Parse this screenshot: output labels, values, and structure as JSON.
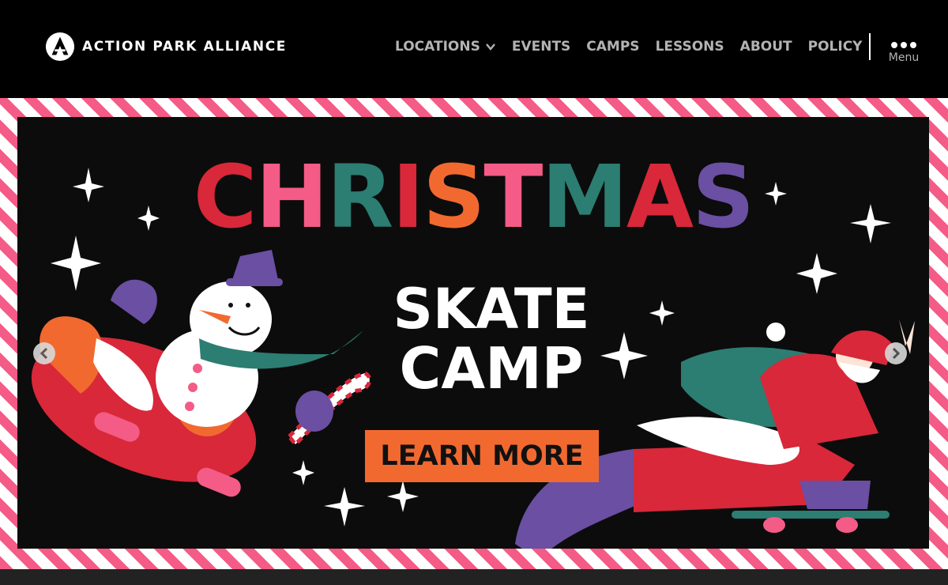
{
  "brand": {
    "name": "ACTION PARK ALLIANCE"
  },
  "nav": {
    "items": [
      {
        "label": "LOCATIONS",
        "has_dropdown": true
      },
      {
        "label": "EVENTS"
      },
      {
        "label": "CAMPS"
      },
      {
        "label": "LESSONS"
      },
      {
        "label": "ABOUT"
      },
      {
        "label": "POLICY"
      }
    ],
    "menu_label": "Menu"
  },
  "banner": {
    "title_letters": [
      "C",
      "H",
      "R",
      "I",
      "S",
      "T",
      "M",
      "A",
      "S"
    ],
    "title_colors": [
      "#d8283a",
      "#f45b86",
      "#2c7d72",
      "#d8283a",
      "#f2692f",
      "#f45b86",
      "#2c7d72",
      "#d8283a",
      "#6a4fa3"
    ],
    "subtitle_line1": "SKATE",
    "subtitle_line2": "CAMP",
    "cta_label": "LEARN MORE",
    "border_colors": [
      "#f45b86",
      "#ffffff"
    ],
    "cta_color": "#f2692f"
  },
  "icons": [
    "logo-icon",
    "chevron-down-icon",
    "more-dots-icon",
    "arrow-left-icon",
    "arrow-right-icon"
  ]
}
